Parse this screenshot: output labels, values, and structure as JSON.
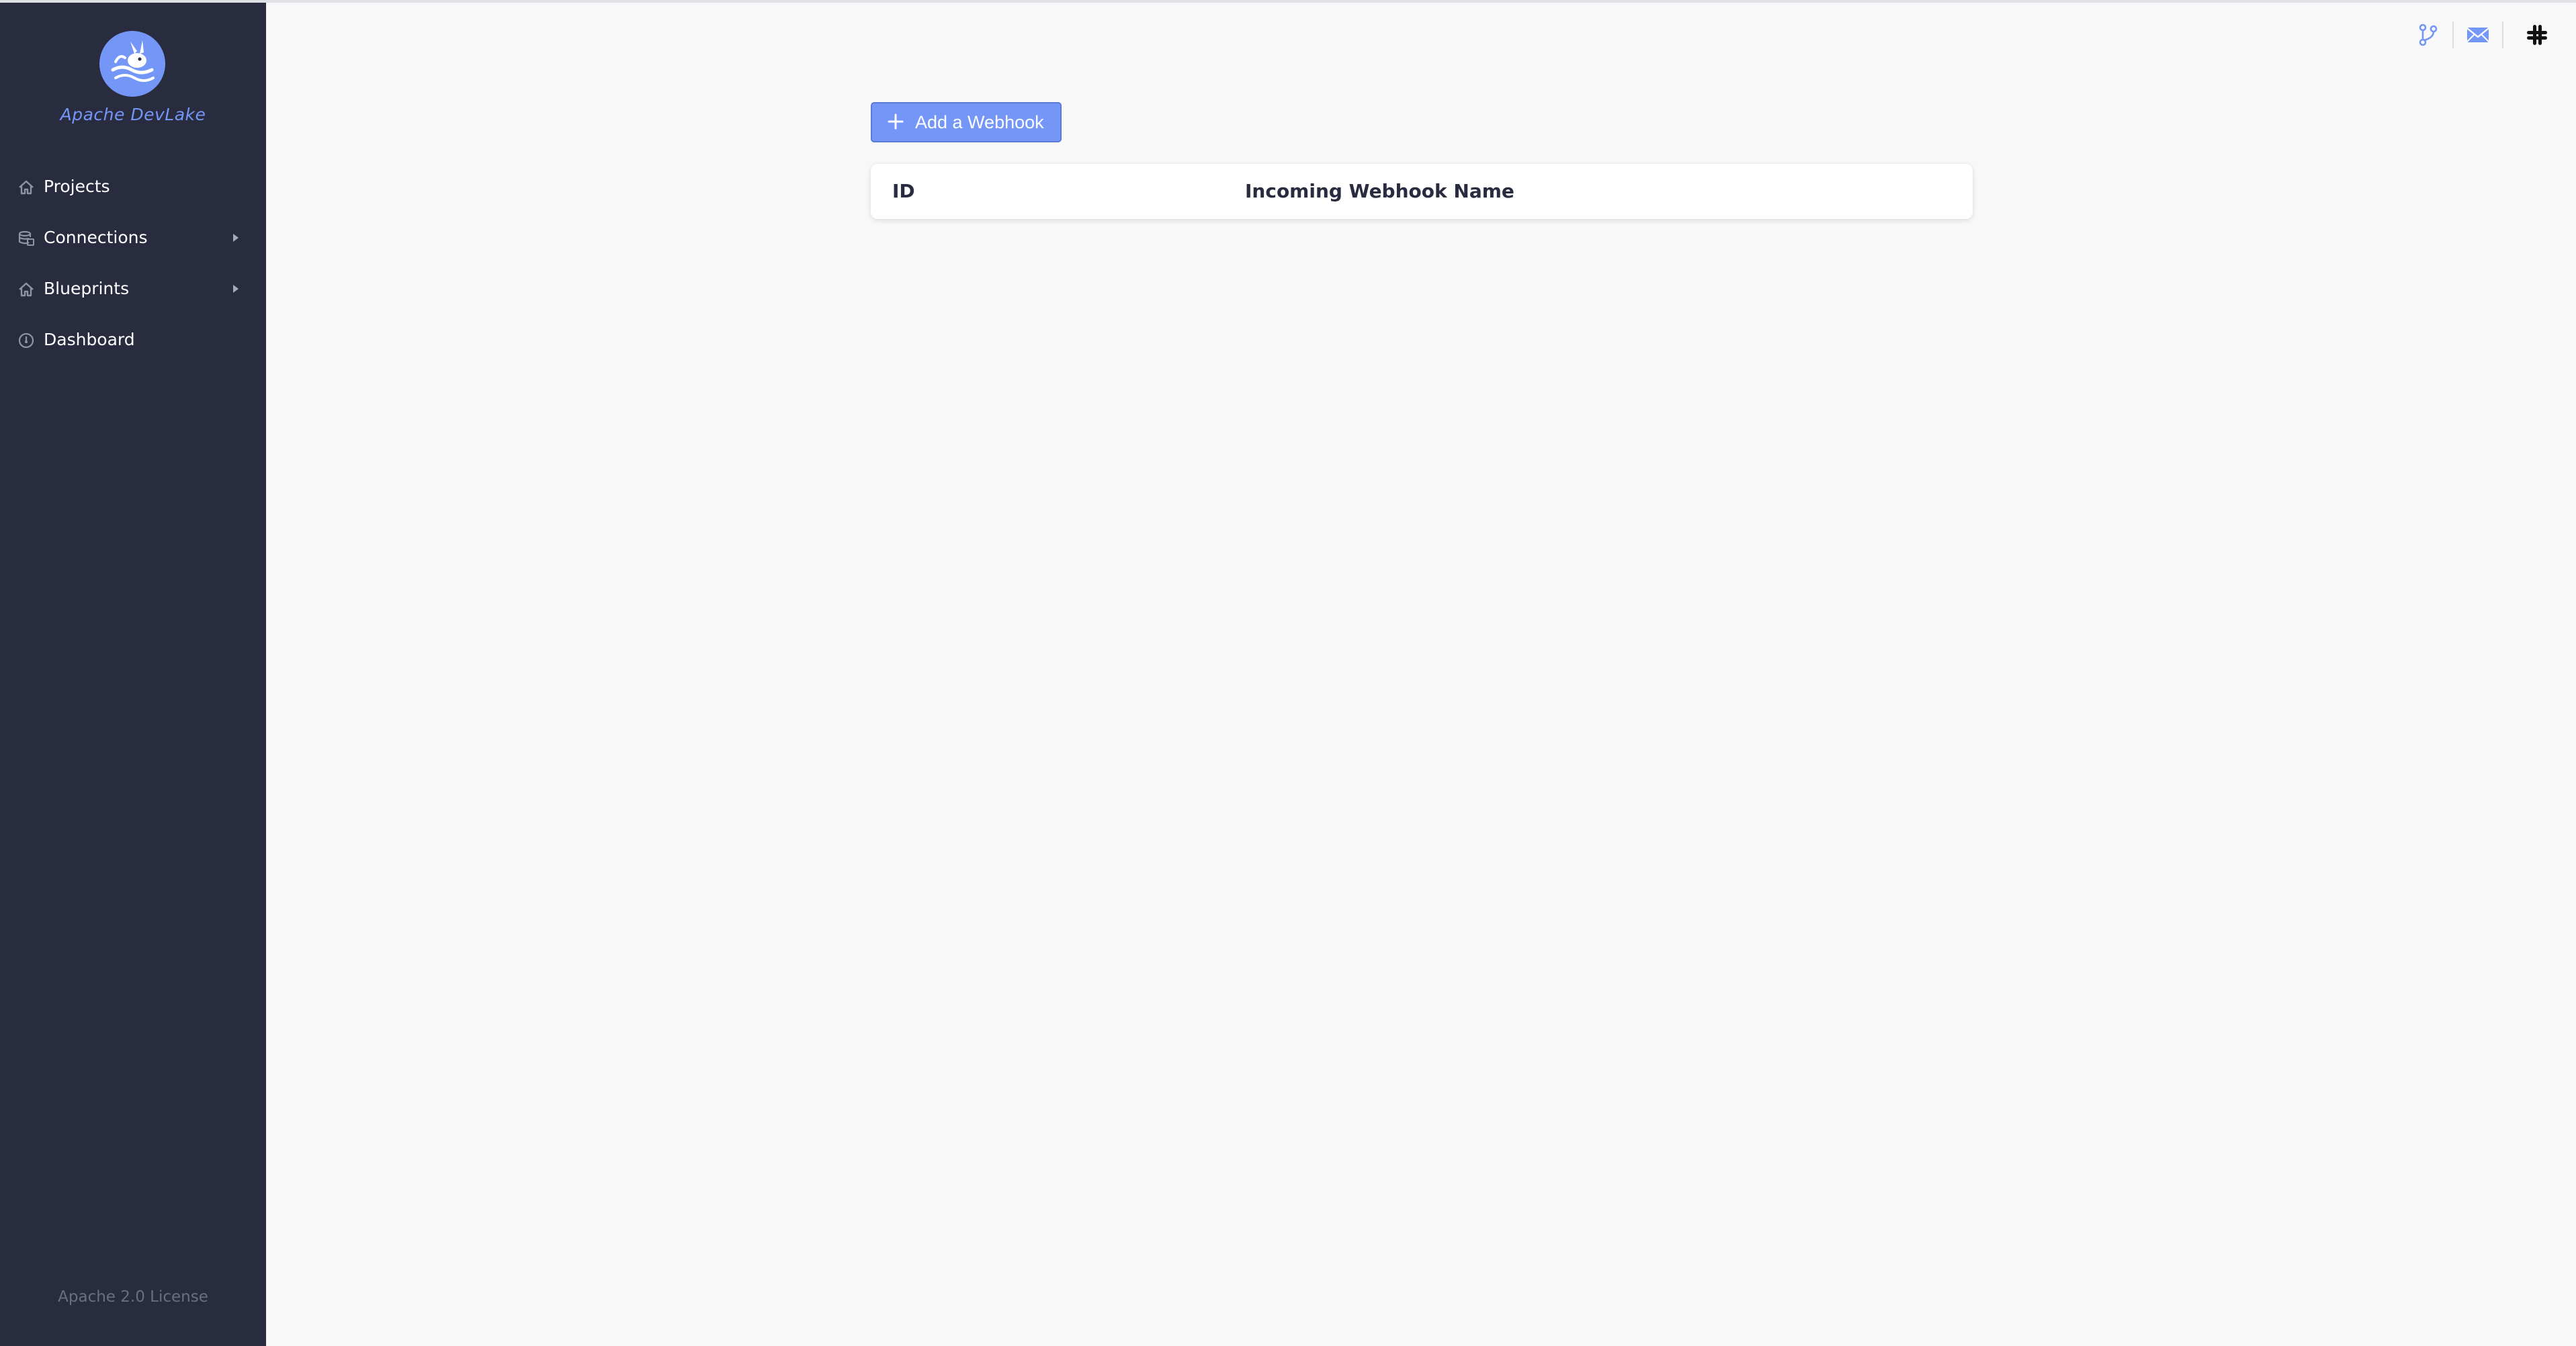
{
  "sidebar": {
    "brand": "Apache DevLake",
    "items": [
      {
        "label": "Projects",
        "icon": "home-icon",
        "has_submenu": false
      },
      {
        "label": "Connections",
        "icon": "database-icon",
        "has_submenu": true
      },
      {
        "label": "Blueprints",
        "icon": "home-icon",
        "has_submenu": true
      },
      {
        "label": "Dashboard",
        "icon": "dashboard-icon",
        "has_submenu": false
      }
    ],
    "footer": "Apache 2.0 License"
  },
  "toolbar": {
    "icons": [
      "git-branch-icon",
      "mail-icon",
      "slack-icon"
    ]
  },
  "main": {
    "add_button_label": "Add a Webhook",
    "table": {
      "columns": [
        "ID",
        "Incoming Webhook Name"
      ],
      "rows": []
    }
  },
  "colors": {
    "sidebar_bg": "#292b3f",
    "accent": "#7497f7",
    "page_bg": "#f8f8f8"
  }
}
